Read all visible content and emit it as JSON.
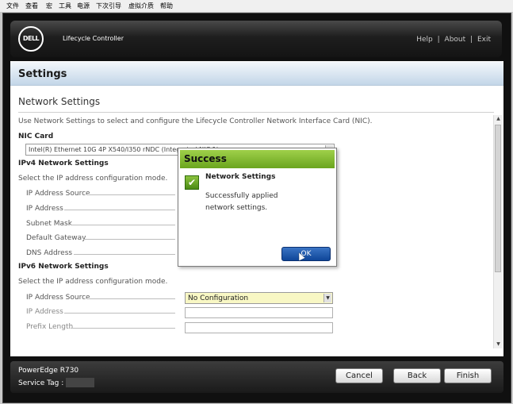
{
  "menubar": [
    "文件",
    "查看",
    "宏",
    "工具",
    "电源",
    "下次引导",
    "虚拟介质",
    "帮助"
  ],
  "header": {
    "logo": "DELL",
    "title": "Lifecycle Controller",
    "links": {
      "help": "Help",
      "about": "About",
      "exit": "Exit",
      "separator": "|"
    }
  },
  "page": {
    "title": "Settings",
    "section_title": "Network Settings",
    "description": "Use Network Settings to select and configure the Lifecycle Controller Network Interface Card (NIC).",
    "nic": {
      "label": "NIC Card",
      "value": "Intel(R) Ethernet 10G 4P X540/I350 rNDC (Integrated NIC 1)"
    },
    "ipv4": {
      "heading": "IPv4 Network Settings",
      "instruction": "Select the IP address configuration mode.",
      "fields": [
        "IP Address Source",
        "IP Address",
        "Subnet Mask",
        "Default Gateway",
        "DNS Address"
      ]
    },
    "ipv6": {
      "heading": "IPv6 Network Settings",
      "instruction": "Select the IP address configuration mode.",
      "fields": [
        "IP Address Source",
        "IP Address",
        "Prefix Length"
      ],
      "source_value": "No Configuration"
    }
  },
  "footer": {
    "model": "PowerEdge R730",
    "service_tag_label": "Service Tag :",
    "buttons": {
      "cancel": "Cancel",
      "back": "Back",
      "finish": "Finish"
    }
  },
  "dialog": {
    "title": "Success",
    "heading": "Network Settings",
    "message": "Successfully applied network settings.",
    "ok": "OK"
  },
  "colors": {
    "dialog_header": "#8cc33f",
    "ok_button": "#1a55a8",
    "page_band": "#c3d6e8",
    "highlight_select": "#f8f7c4"
  },
  "icons": [
    "dell-logo",
    "check-icon",
    "dropdown-arrow-icon",
    "scroll-up-icon",
    "scroll-down-icon",
    "mouse-cursor-icon"
  ]
}
